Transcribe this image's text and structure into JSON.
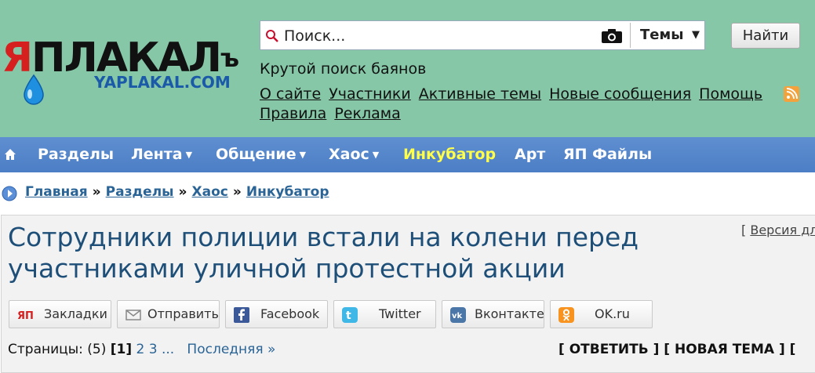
{
  "logo": {
    "main": "ЯПЛАКАЛ",
    "ya": "Я",
    "rest": "ПЛАКАЛ",
    "yer": "ъ",
    "sub": "YAPLAKAL.COM",
    "ya_color": "#d62020",
    "sub_color": "#1a5aa8"
  },
  "search": {
    "placeholder": "Поиск...",
    "themes_label": "Темы",
    "find_label": "Найти"
  },
  "tagline": "Крутой поиск баянов",
  "top_links": [
    "О сайте",
    "Участники",
    "Активные темы",
    "Новые сообщения",
    "Помощь",
    "Правила",
    "Реклама"
  ],
  "nav": {
    "items": [
      {
        "label": "Разделы",
        "dropdown": false
      },
      {
        "label": "Лента",
        "dropdown": true
      },
      {
        "label": "Общение",
        "dropdown": true
      },
      {
        "label": "Хаос",
        "dropdown": true
      },
      {
        "label": "Инкубатор",
        "dropdown": false,
        "highlight": true
      },
      {
        "label": "Арт",
        "dropdown": false
      },
      {
        "label": "ЯП Файлы",
        "dropdown": false
      }
    ],
    "highlight_color": "#ffff4a",
    "bg_color": "#5585cb"
  },
  "breadcrumb": [
    "Главная",
    "Разделы",
    "Хаос",
    "Инкубатор"
  ],
  "breadcrumb_sep": "»",
  "topic": {
    "title": "Сотрудники полиции встали на колени перед участниками уличной протестной акции",
    "print_bracket": "[",
    "print_link": "Версия дл"
  },
  "share": [
    {
      "label": "Закладки",
      "icon": "yap-icon"
    },
    {
      "label": "Отправить",
      "icon": "mail-icon"
    },
    {
      "label": "Facebook",
      "icon": "facebook-icon"
    },
    {
      "label": "Twitter",
      "icon": "twitter-icon"
    },
    {
      "label": "Вконтакте",
      "icon": "vk-icon"
    },
    {
      "label": "OK.ru",
      "icon": "ok-icon"
    }
  ],
  "pagination": {
    "prefix": "Страницы: (5)",
    "current": "[1]",
    "pages": "2 3 ...",
    "last": "Последняя »"
  },
  "reply_links": "[ ОТВЕТИТЬ ] [ НОВАЯ ТЕМА ] [",
  "colors": {
    "header_bg": "#86c7a7",
    "link": "#2a6496",
    "title": "#1e4f78"
  }
}
